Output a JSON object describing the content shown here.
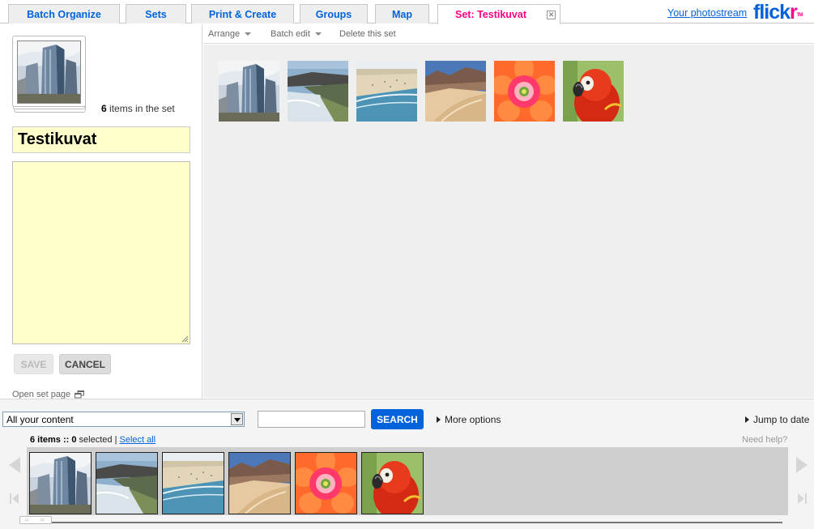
{
  "tabs": [
    {
      "label": "Batch Organize"
    },
    {
      "label": "Sets"
    },
    {
      "label": "Print & Create"
    },
    {
      "label": "Groups"
    },
    {
      "label": "Map"
    },
    {
      "label": "Set: Testikuvat",
      "active": true
    }
  ],
  "header": {
    "photostream_link": "Your photostream",
    "logo_blue": "flick",
    "logo_pink": "r",
    "logo_tm": "TM"
  },
  "set": {
    "count": "6",
    "count_suffix": " items in the set",
    "title": "Testikuvat",
    "description": "",
    "save_label": "SAVE",
    "cancel_label": "CANCEL",
    "open_set_label": "Open set page"
  },
  "toolbar": {
    "arrange": "Arrange",
    "batch_edit": "Batch edit",
    "delete_set": "Delete this set"
  },
  "photos": [
    {
      "name": "skyscrapers-photo",
      "icon": "skyscrapers"
    },
    {
      "name": "rocky-coast-photo",
      "icon": "rocky-coast"
    },
    {
      "name": "beach-photo",
      "icon": "beach"
    },
    {
      "name": "desert-dunes-photo",
      "icon": "desert-dunes"
    },
    {
      "name": "cactus-flower-photo",
      "icon": "cactus-flower"
    },
    {
      "name": "parrot-photo",
      "icon": "parrot"
    }
  ],
  "organizer": {
    "content_filter": "All your content",
    "search_value": "",
    "search_label": "SEARCH",
    "more_options": "More options",
    "jump_to_date": "Jump to date",
    "items_count": "6",
    "items_text": " items :: ",
    "selected_count": "0",
    "selected_text": " selected | ",
    "select_all": "Select all",
    "need_help": "Need help?"
  },
  "colors": {
    "link_blue": "#0063dc",
    "flickr_pink": "#ff0084",
    "field_yellow": "#ffffcc",
    "search_button": "#0063dc"
  }
}
